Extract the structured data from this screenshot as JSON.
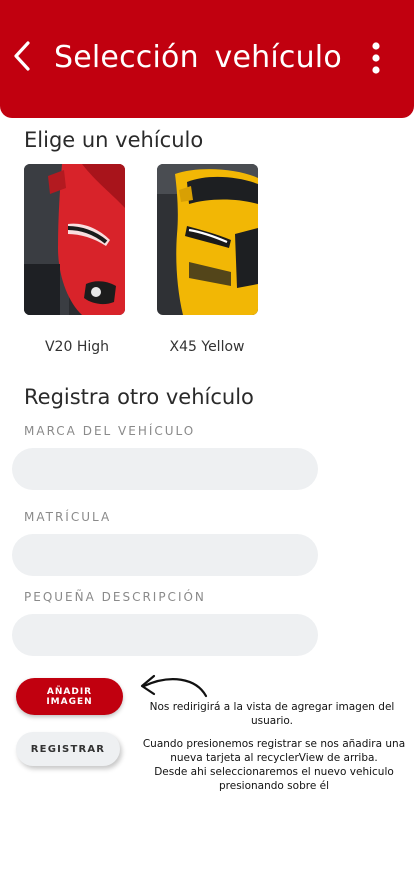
{
  "app_bar": {
    "title": "Selección  vehículo",
    "back_icon": "chevron-left-icon",
    "menu_icon": "more-vertical-icon",
    "color": "#c1000f"
  },
  "vehicles_section": {
    "title": "Elige un vehículo",
    "vehicles": [
      {
        "name": "V20 High",
        "image": "red-sports-car",
        "color": "#d8232a"
      },
      {
        "name": "X45 Yellow",
        "image": "yellow-sports-car",
        "color": "#f2b705"
      }
    ]
  },
  "register_section": {
    "title": "Registra otro vehículo",
    "fields": [
      {
        "label": "MARCA DEL VEHÍCULO",
        "value": "",
        "placeholder": ""
      },
      {
        "label": "MATRÍCULA",
        "value": "",
        "placeholder": ""
      },
      {
        "label": "PEQUEÑA DESCRIPCIÓN",
        "value": "",
        "placeholder": ""
      }
    ],
    "add_image_label": "AÑADIR IMAGEN",
    "register_label": "REGISTRAR"
  },
  "notes": {
    "add_image_line1": "Nos redirigirá a la vista de agregar imagen del",
    "add_image_line2": "usuario.",
    "register_line1": "Cuando presionemos registrar se nos añadira una",
    "register_line2": "nueva tarjeta al recyclerView de arriba.",
    "register_line3": "Desde ahi seleccionaremos el nuevo vehiculo",
    "register_line4": "presionando sobre él"
  }
}
